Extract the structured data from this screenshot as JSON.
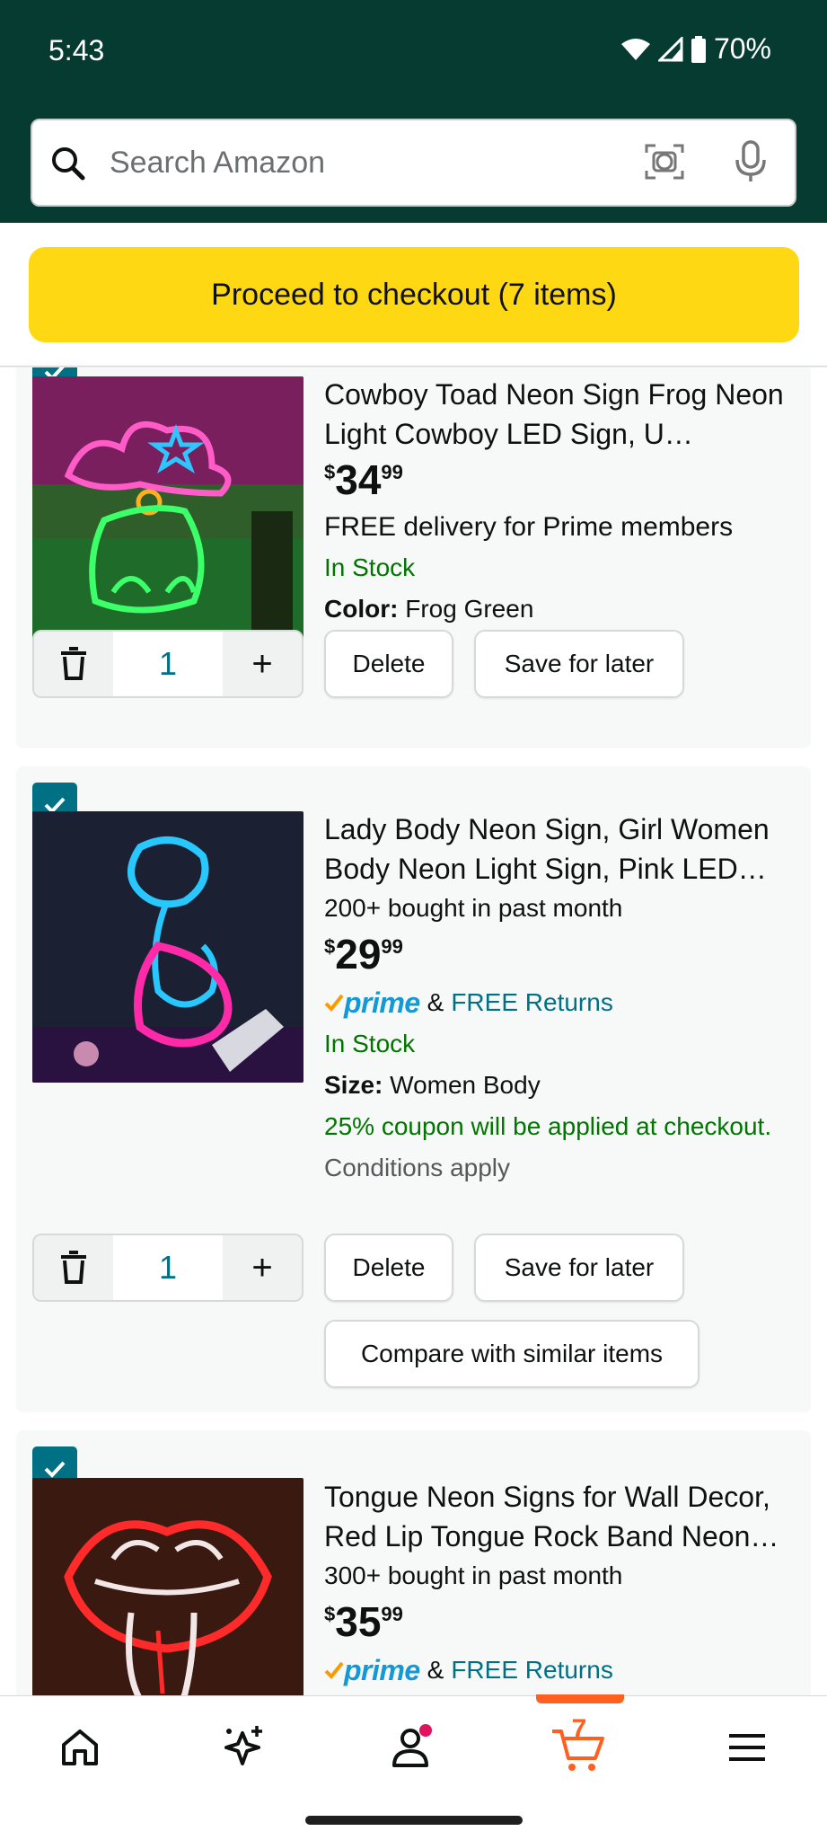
{
  "status": {
    "time": "5:43",
    "battery": "70%"
  },
  "search": {
    "placeholder": "Search Amazon"
  },
  "checkout": {
    "label": "Proceed to checkout (7 items)"
  },
  "items": [
    {
      "title": "Cowboy Toad Neon Sign Frog Neon Light Cowboy LED Sign, U…",
      "price_currency": "$",
      "price_whole": "34",
      "price_fraction": "99",
      "delivery": "FREE delivery for Prime members",
      "stock": "In Stock",
      "attr_label": "Color:",
      "attr_value": "Frog Green",
      "quantity": "1",
      "delete_label": "Delete",
      "save_label": "Save for later"
    },
    {
      "title": "Lady Body Neon Sign, Girl Women Body Neon Light Sign, Pink LED…",
      "bought": "200+ bought in past month",
      "price_currency": "$",
      "price_whole": "29",
      "price_fraction": "99",
      "prime_word": "prime",
      "amp": "&",
      "free_returns": "FREE Returns",
      "stock": "In Stock",
      "attr_label": "Size:",
      "attr_value": "Women Body",
      "coupon": "25% coupon will be applied at checkout.",
      "coupon_conditions": "Conditions apply",
      "quantity": "1",
      "delete_label": "Delete",
      "save_label": "Save for later",
      "compare_label": "Compare with similar items"
    },
    {
      "title": "Tongue Neon Signs for Wall Decor, Red Lip Tongue Rock Band Neon…",
      "bought": "300+ bought in past month",
      "price_currency": "$",
      "price_whole": "35",
      "price_fraction": "99",
      "prime_word": "prime",
      "amp": "&",
      "free_returns": "FREE Returns"
    }
  ],
  "nav": {
    "cart_count": "7"
  },
  "colors": {
    "brand_dark": "#063b32",
    "checkout_yellow": "#ffd814",
    "link_teal": "#007185",
    "stock_green": "#007600",
    "cart_orange": "#ff5f1f",
    "prime_blue": "#1399d6"
  }
}
